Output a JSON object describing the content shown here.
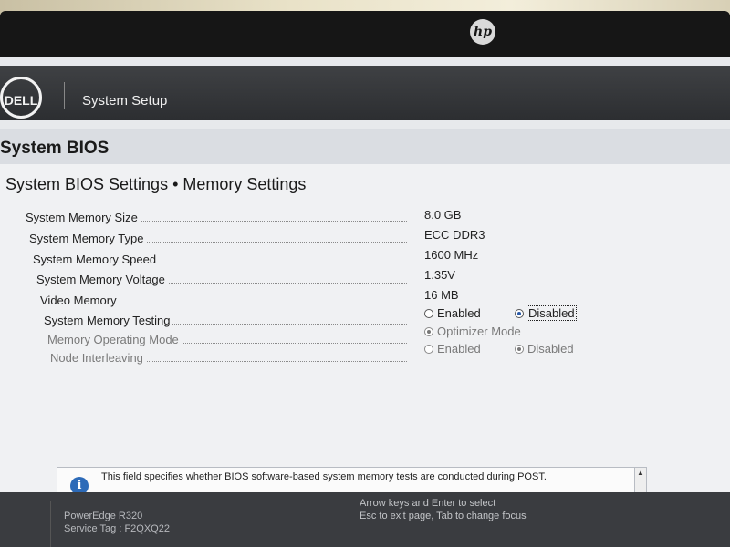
{
  "monitor": {
    "logo": "hp"
  },
  "header": {
    "brand": "DELL",
    "title": "System Setup"
  },
  "section": {
    "title": "System BIOS"
  },
  "breadcrumb": "System BIOS Settings • Memory Settings",
  "settings": [
    {
      "label": "System Memory Size",
      "value": "8.0 GB"
    },
    {
      "label": "System Memory Type",
      "value": "ECC DDR3"
    },
    {
      "label": "System Memory Speed",
      "value": "1600 MHz"
    },
    {
      "label": "System Memory Voltage",
      "value": "1.35V"
    },
    {
      "label": "Video Memory",
      "value": "16 MB"
    },
    {
      "label": "System Memory Testing",
      "options": [
        "Enabled",
        "Disabled"
      ],
      "selected": "Disabled"
    },
    {
      "label": "Memory Operating Mode",
      "options": [
        "Optimizer Mode"
      ],
      "selected": "Optimizer Mode"
    },
    {
      "label": "Node Interleaving",
      "options": [
        "Enabled",
        "Disabled"
      ],
      "selected": "Disabled"
    }
  ],
  "help": {
    "icon": "info-icon",
    "text": "This field specifies whether BIOS software-based system memory tests are conducted during POST."
  },
  "footer": {
    "model": "PowerEdge R320",
    "service_tag": "Service Tag : F2QXQ22",
    "hint_line1": "Arrow keys and Enter to select",
    "hint_line2": "Esc to exit page, Tab to change focus"
  },
  "colors": {
    "header_bg": "#2c2e31",
    "accent": "#2c6ab8",
    "panel_bg": "#f0f1f3"
  }
}
